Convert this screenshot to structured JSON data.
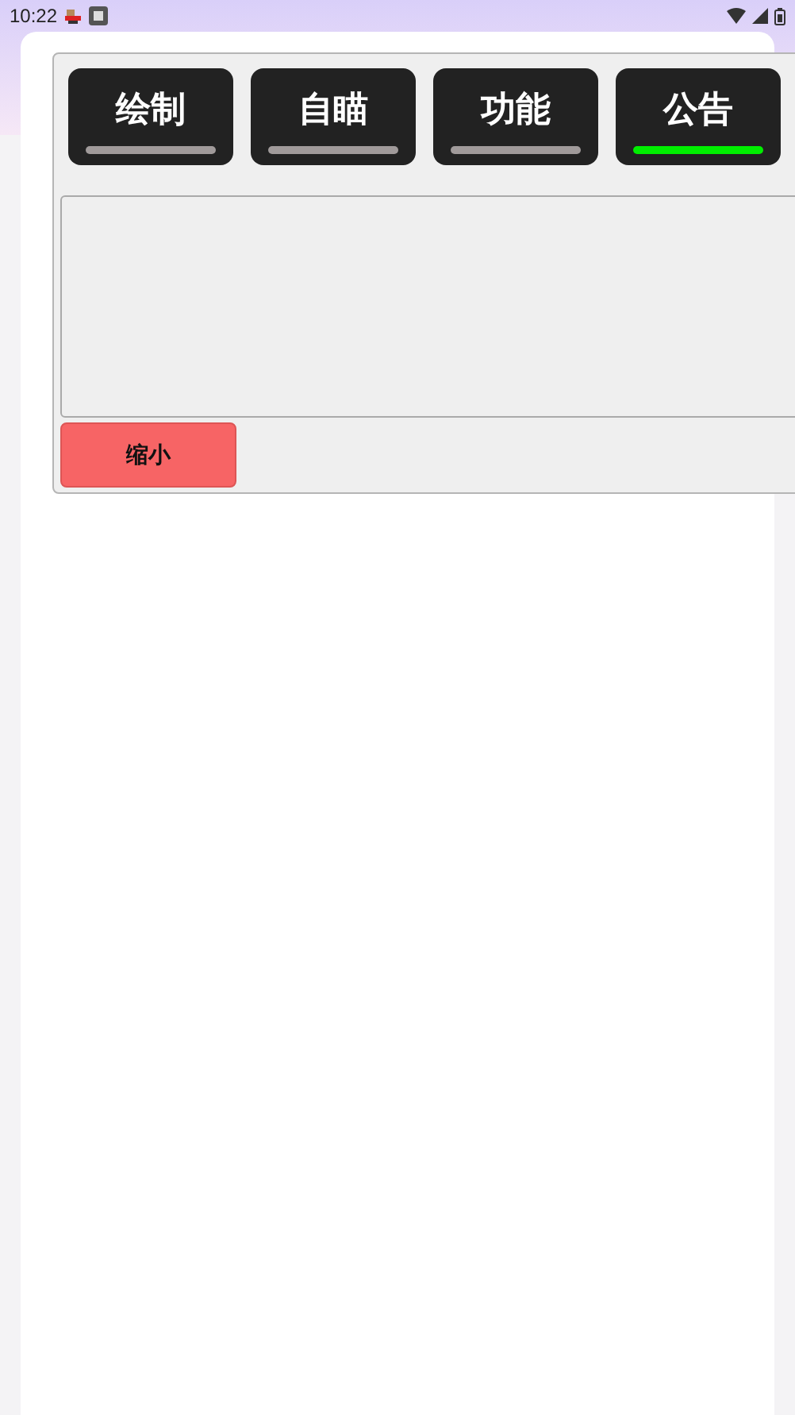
{
  "status_bar": {
    "time": "10:22"
  },
  "tabs": [
    {
      "label": "绘制",
      "selected": false
    },
    {
      "label": "自瞄",
      "selected": false
    },
    {
      "label": "功能",
      "selected": false
    },
    {
      "label": "公告",
      "selected": true
    }
  ],
  "shrink_button": {
    "label": "缩小"
  }
}
